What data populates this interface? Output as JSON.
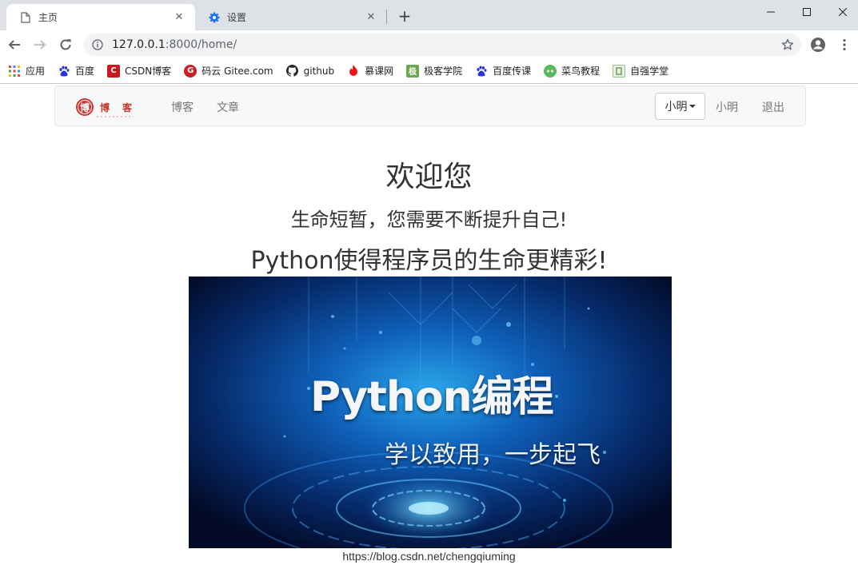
{
  "browser": {
    "tabs": [
      {
        "title": "主页",
        "icon": "page-icon",
        "active": true
      },
      {
        "title": "设置",
        "icon": "gear-icon",
        "active": false
      }
    ],
    "address": {
      "host": "127.0.0.1",
      "rest": ":8000/home/"
    },
    "bookmarks": [
      {
        "label": "应用",
        "icon": "apps-grid-icon"
      },
      {
        "label": "百度",
        "icon": "baidu-paw-icon"
      },
      {
        "label": "CSDN博客",
        "icon": "csdn-icon"
      },
      {
        "label": "码云 Gitee.com",
        "icon": "gitee-icon"
      },
      {
        "label": "github",
        "icon": "github-icon"
      },
      {
        "label": "慕课网",
        "icon": "imooc-flame-icon"
      },
      {
        "label": "极客学院",
        "icon": "jikexueyuan-icon"
      },
      {
        "label": "百度传课",
        "icon": "baidu-paw-icon"
      },
      {
        "label": "菜鸟教程",
        "icon": "runoob-icon"
      },
      {
        "label": "自强学堂",
        "icon": "ziqiang-icon"
      }
    ],
    "colors": {
      "tabstrip": "#dee1e6",
      "omnibox": "#f1f3f4",
      "accent": "#1a73e8"
    }
  },
  "navbar": {
    "brand_logo": "blog-logo",
    "links": [
      "博客",
      "文章"
    ],
    "user_dropdown": "小明",
    "user_link": "小明",
    "logout": "退出"
  },
  "hero": {
    "welcome": "欢迎您",
    "motto": "生命短暂，您需要不断提升自己!",
    "python_line": "Python使得程序员的生命更精彩!"
  },
  "banner": {
    "title": "Python编程",
    "subtitle": "学以致用，一步起飞"
  },
  "caption": "https://blog.csdn.net/chengqiuming"
}
